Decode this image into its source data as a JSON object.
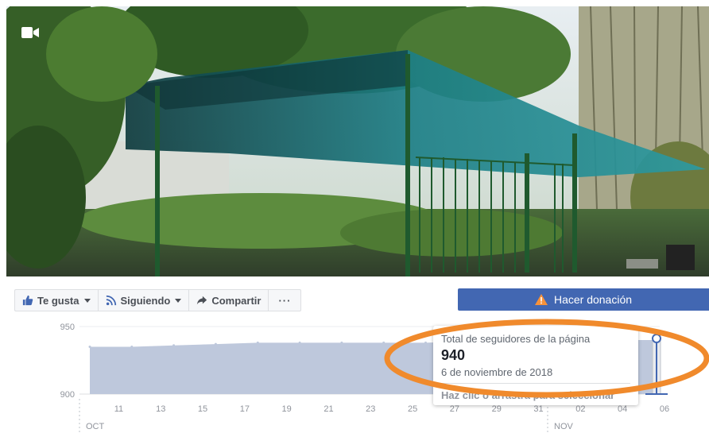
{
  "colors": {
    "brand_blue": "#4267b2",
    "chart_fill": "#bec8dc",
    "annotation_orange": "#f08a2c",
    "warning_orange": "#f7923a"
  },
  "icons": {
    "cover_video": "video-camera-icon",
    "like": "thumbs-up-icon",
    "following": "rss-icon",
    "share": "share-arrow-icon",
    "more": "ellipsis-icon",
    "donate": "warning-triangle-icon"
  },
  "action_bar": {
    "like_label": "Te gusta",
    "following_label": "Siguiendo",
    "share_label": "Compartir",
    "more_label": "···"
  },
  "donate_label": "Hacer donación",
  "tooltip": {
    "label": "Total de seguidores de la página",
    "value": "940",
    "date": "6 de noviembre de 2018",
    "hint": "Haz clic o arrastra para seleccionar"
  },
  "chart_data": {
    "type": "area",
    "ylim": [
      900,
      950
    ],
    "y_ticks": [
      "950",
      "900"
    ],
    "x_tick_labels": [
      "11",
      "13",
      "15",
      "17",
      "19",
      "21",
      "23",
      "25",
      "27",
      "29",
      "31",
      "02",
      "04",
      "06"
    ],
    "month_labels": [
      "OCT",
      "NOV"
    ],
    "x": [
      "2018-10-10",
      "2018-10-12",
      "2018-10-14",
      "2018-10-16",
      "2018-10-18",
      "2018-10-20",
      "2018-10-22",
      "2018-10-24",
      "2018-10-26",
      "2018-10-28",
      "2018-10-30",
      "2018-11-01",
      "2018-11-03",
      "2018-11-05",
      "2018-11-06"
    ],
    "values": [
      935,
      935,
      936,
      937,
      938,
      938,
      938,
      938,
      938,
      939,
      939,
      939,
      939,
      940,
      940
    ],
    "grid": false,
    "selected_date": "2018-11-06",
    "selected_value": 940
  }
}
